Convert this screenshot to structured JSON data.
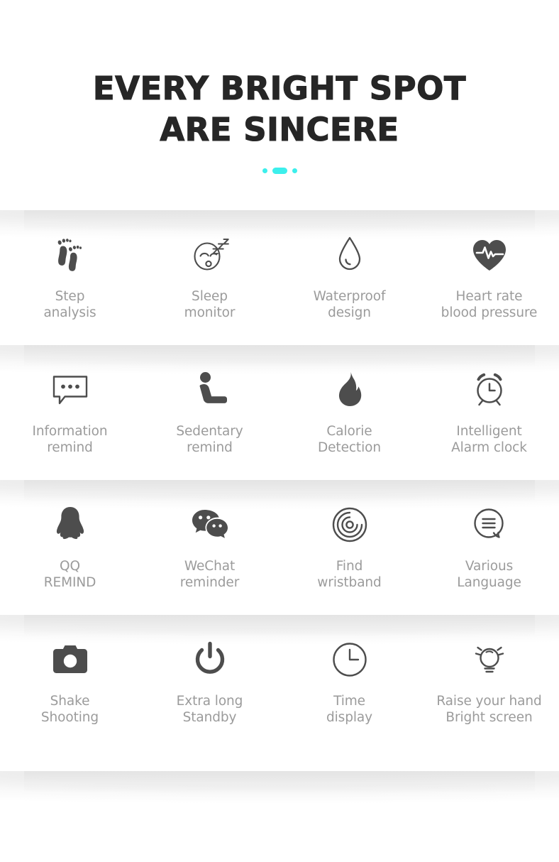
{
  "page": {
    "background_color": "#ffffff",
    "icon_color": "#4d4d4d",
    "label_color": "#9b9b9b",
    "accent_color": "#3CEFEC",
    "heading_color": "#262626"
  },
  "hero": {
    "title_line_1": "EVERY BRIGHT SPOT",
    "title_line_2": "ARE SINCERE",
    "divider": {
      "name": "accent-dots",
      "color": "#3CEFEC",
      "shapes": [
        "dot",
        "bar",
        "dot"
      ]
    }
  },
  "rows": [
    {
      "cells": [
        {
          "icon": "footprints-icon",
          "label": "Step\nanalysis"
        },
        {
          "icon": "sleeping-face-icon",
          "label": "Sleep\nmonitor"
        },
        {
          "icon": "water-drop-icon",
          "label": "Waterproof\ndesign"
        },
        {
          "icon": "heart-pulse-icon",
          "label": "Heart rate\nblood pressure"
        }
      ]
    },
    {
      "cells": [
        {
          "icon": "speech-bubble-dots-icon",
          "label": "Information\nremind"
        },
        {
          "icon": "sitting-person-icon",
          "label": "Sedentary\nremind"
        },
        {
          "icon": "flame-icon",
          "label": "Calorie\nDetection"
        },
        {
          "icon": "alarm-clock-icon",
          "label": "Intelligent\nAlarm clock"
        }
      ]
    },
    {
      "cells": [
        {
          "icon": "qq-penguin-icon",
          "label": "QQ\nREMIND"
        },
        {
          "icon": "wechat-bubbles-icon",
          "label": "WeChat\nreminder"
        },
        {
          "icon": "radar-target-icon",
          "label": "Find\nwristband"
        },
        {
          "icon": "speech-bubble-lines-icon",
          "label": "Various\nLanguage"
        }
      ]
    },
    {
      "cells": [
        {
          "icon": "camera-icon",
          "label": "Shake\nShooting"
        },
        {
          "icon": "power-icon",
          "label": "Extra long\nStandby"
        },
        {
          "icon": "clock-icon",
          "label": "Time\ndisplay"
        },
        {
          "icon": "light-bulb-icon",
          "label": "Raise your hand\nBright screen"
        }
      ]
    }
  ]
}
